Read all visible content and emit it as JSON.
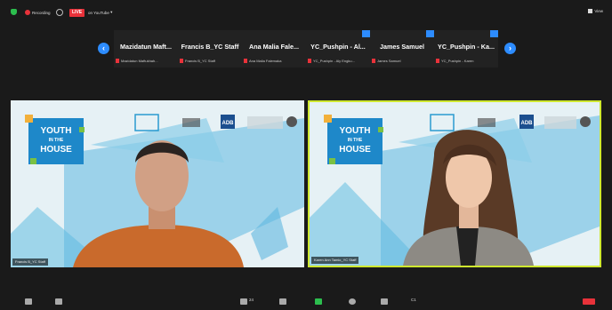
{
  "top_bar": {
    "recording_label": "Recording",
    "live_badge": "LIVE",
    "stream_target": "on YouTube",
    "view_label": "View"
  },
  "participants": [
    {
      "name": "Mazidatun  Maft...",
      "subtitle": "Mazidatun Maftukhah..."
    },
    {
      "name": "Francis B_YC Staff",
      "subtitle": "Francis B_YC Staff"
    },
    {
      "name": "Ana  Malia  Fale...",
      "subtitle": "Ana Malia Falemaka"
    },
    {
      "name": "YC_Pushpin - Al...",
      "subtitle": "YC_Pushpin - Aly Engku..."
    },
    {
      "name": "James Samuel",
      "subtitle": "James Samuel"
    },
    {
      "name": "YC_Pushpin  -  Ka...",
      "subtitle": "YC_Pushpin - Karen"
    }
  ],
  "videos": [
    {
      "name_label": "Francis B_YC Staff",
      "banner_lines": [
        "YOUTH",
        "IN THE",
        "HOUSE"
      ],
      "partner_text": "ADB"
    },
    {
      "name_label": "Karen Ann Tamio_YC Staff",
      "banner_lines": [
        "YOUTH",
        "IN THE",
        "HOUSE"
      ],
      "partner_text": "ADB"
    }
  ],
  "toolbar": {
    "participants_count": "24",
    "chat_count": "C1"
  },
  "colors": {
    "accent": "#2d8cff",
    "live": "#e8323a",
    "active_speaker_border": "#cfe82f",
    "recording_shield": "#2cbe4e"
  },
  "icons": [
    "shield-icon",
    "record-icon",
    "pause-icon",
    "chevron-left-icon",
    "chevron-right-icon",
    "mic-off-icon",
    "view-icon"
  ]
}
